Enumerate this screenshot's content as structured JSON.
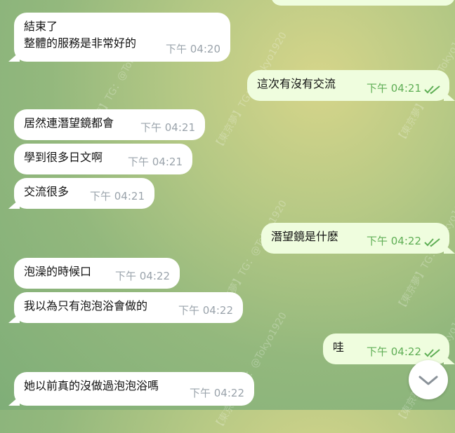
{
  "watermark": "【東京夢】TG：@Tokyo1920",
  "messages": [
    {
      "dir": "in",
      "text_lines": [
        "結束了",
        "整體的服務是非常好的"
      ],
      "time": "下午 04:20"
    },
    {
      "dir": "out",
      "text_lines": [
        "這次有沒有交流"
      ],
      "time": "下午 04:21",
      "status": "read"
    },
    {
      "dir": "in",
      "text_lines": [
        "居然連潛望鏡都會"
      ],
      "time": "下午 04:21"
    },
    {
      "dir": "in",
      "text_lines": [
        "學到很多日文啊"
      ],
      "time": "下午 04:21"
    },
    {
      "dir": "in",
      "text_lines": [
        "交流很多"
      ],
      "time": "下午 04:21"
    },
    {
      "dir": "out",
      "text_lines": [
        "潛望鏡是什麽"
      ],
      "time": "下午 04:22",
      "status": "read"
    },
    {
      "dir": "in",
      "text_lines": [
        "泡澡的時候口"
      ],
      "time": "下午 04:22"
    },
    {
      "dir": "in",
      "text_lines": [
        "我以為只有泡泡浴會做的"
      ],
      "time": "下午 04:22"
    },
    {
      "dir": "out",
      "text_lines": [
        "哇"
      ],
      "time": "下午 04:22",
      "status": "read"
    },
    {
      "dir": "in",
      "text_lines": [
        "她以前真的沒做過泡泡浴嗎"
      ],
      "time": "下午 04:22"
    }
  ],
  "scroll_button": {
    "icon": "chevron-down-icon"
  },
  "colors": {
    "incoming": "#ffffff",
    "outgoing": "#effdde",
    "time_in": "#9aa3ab",
    "time_out": "#5fae55"
  }
}
